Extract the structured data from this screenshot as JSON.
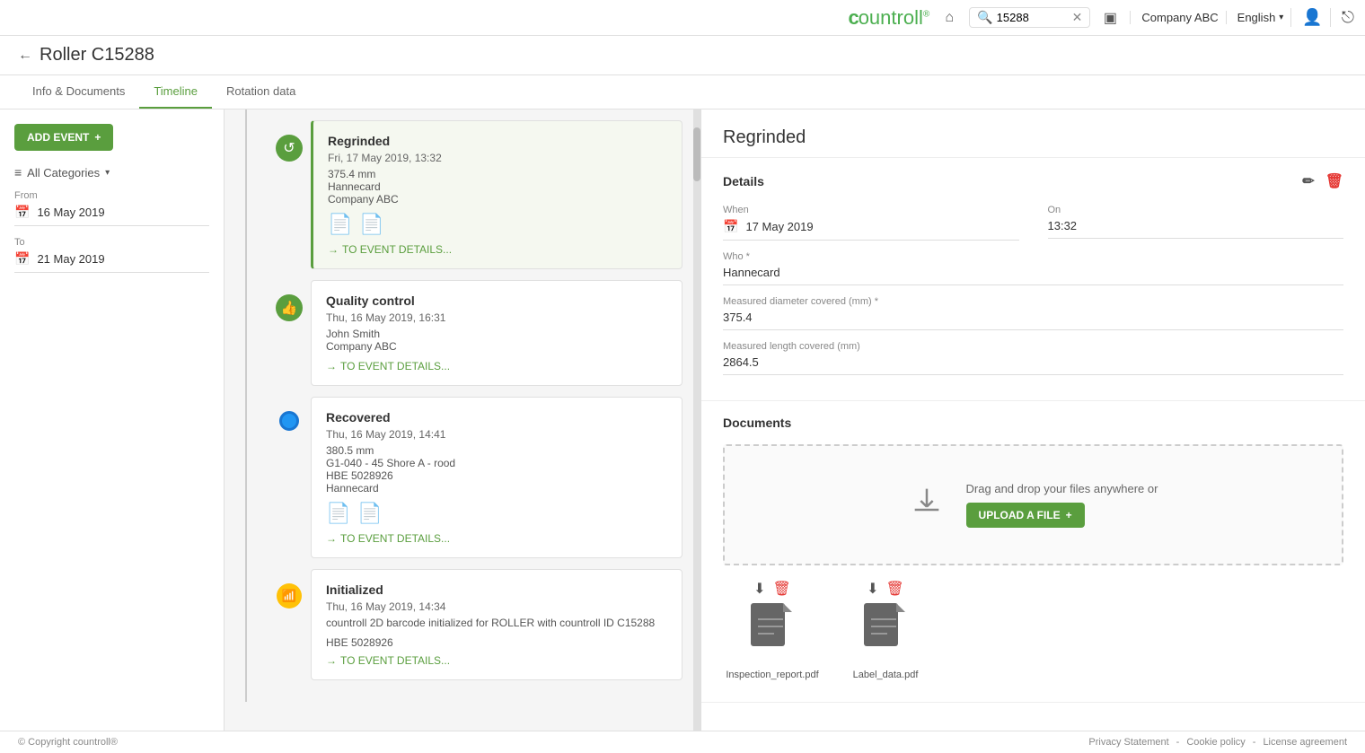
{
  "topnav": {
    "logo": "countroll",
    "search_value": "15288",
    "company": "Company ABC",
    "language": "English",
    "home_icon": "⌂",
    "search_icon": "🔍",
    "clear_icon": "✕",
    "company_icon": "▣",
    "user_icon": "👤",
    "logout_icon": "⎋"
  },
  "page": {
    "back_label": "←",
    "title": "Roller C15288"
  },
  "tabs": [
    {
      "label": "Info & Documents",
      "active": false
    },
    {
      "label": "Timeline",
      "active": true
    },
    {
      "label": "Rotation data",
      "active": false
    }
  ],
  "sidebar": {
    "add_event_label": "ADD EVENT",
    "add_event_plus": "+",
    "filter_label": "All Categories",
    "from_label": "From",
    "from_date": "16 May 2019",
    "to_label": "To",
    "to_date": "21 May 2019"
  },
  "timeline_events": [
    {
      "id": "ev1",
      "title": "Regrinded",
      "date": "Fri, 17 May 2019, 13:32",
      "measurement": "375.4 mm",
      "person": "Hannecard",
      "company": "Company ABC",
      "has_docs": true,
      "link_label": "TO EVENT DETAILS...",
      "highlighted": true,
      "icon_type": "green_cycle"
    },
    {
      "id": "ev2",
      "title": "Quality control",
      "date": "Thu, 16 May 2019, 16:31",
      "person": "John Smith",
      "company": "Company ABC",
      "has_docs": false,
      "link_label": "TO EVENT DETAILS...",
      "highlighted": false,
      "icon_type": "thumb_up"
    },
    {
      "id": "ev3",
      "title": "Recovered",
      "date": "Thu, 16 May 2019, 14:41",
      "measurement": "380.5 mm",
      "detail": "G1-040 - 45 Shore A - rood",
      "hbe": "HBE 5028926",
      "person": "Hannecard",
      "has_docs": true,
      "link_label": "TO EVENT DETAILS...",
      "highlighted": false,
      "icon_type": "blue_circle"
    },
    {
      "id": "ev4",
      "title": "Initialized",
      "date": "Thu, 16 May 2019, 14:34",
      "desc": "countroll 2D barcode initialized for ROLLER with countroll ID C15288",
      "hbe": "HBE 5028926",
      "has_docs": false,
      "link_label": "TO EVENT DETAILS...",
      "highlighted": false,
      "icon_type": "yellow_wifi"
    }
  ],
  "right_panel": {
    "title": "Regrinded",
    "details_label": "Details",
    "edit_icon": "✏",
    "delete_icon": "🗑",
    "when_label": "When",
    "when_value": "17 May 2019",
    "on_label": "On",
    "on_value": "13:32",
    "who_label": "Who *",
    "who_value": "Hannecard",
    "diameter_label": "Measured diameter covered (mm) *",
    "diameter_value": "375.4",
    "length_label": "Measured length covered (mm)",
    "length_value": "2864.5",
    "documents_label": "Documents",
    "drag_drop_text": "Drag and drop your files anywhere or",
    "upload_label": "UPLOAD A FILE",
    "upload_plus": "+",
    "doc1_name": "Inspection_report.pdf",
    "doc2_name": "Label_data.pdf",
    "download_icon": "⬇",
    "delete_doc_icon": "🗑"
  },
  "footer": {
    "copyright": "© Copyright countroll®",
    "links": [
      {
        "label": "Privacy Statement"
      },
      {
        "label": "Cookie policy"
      },
      {
        "label": "License agreement"
      }
    ]
  }
}
